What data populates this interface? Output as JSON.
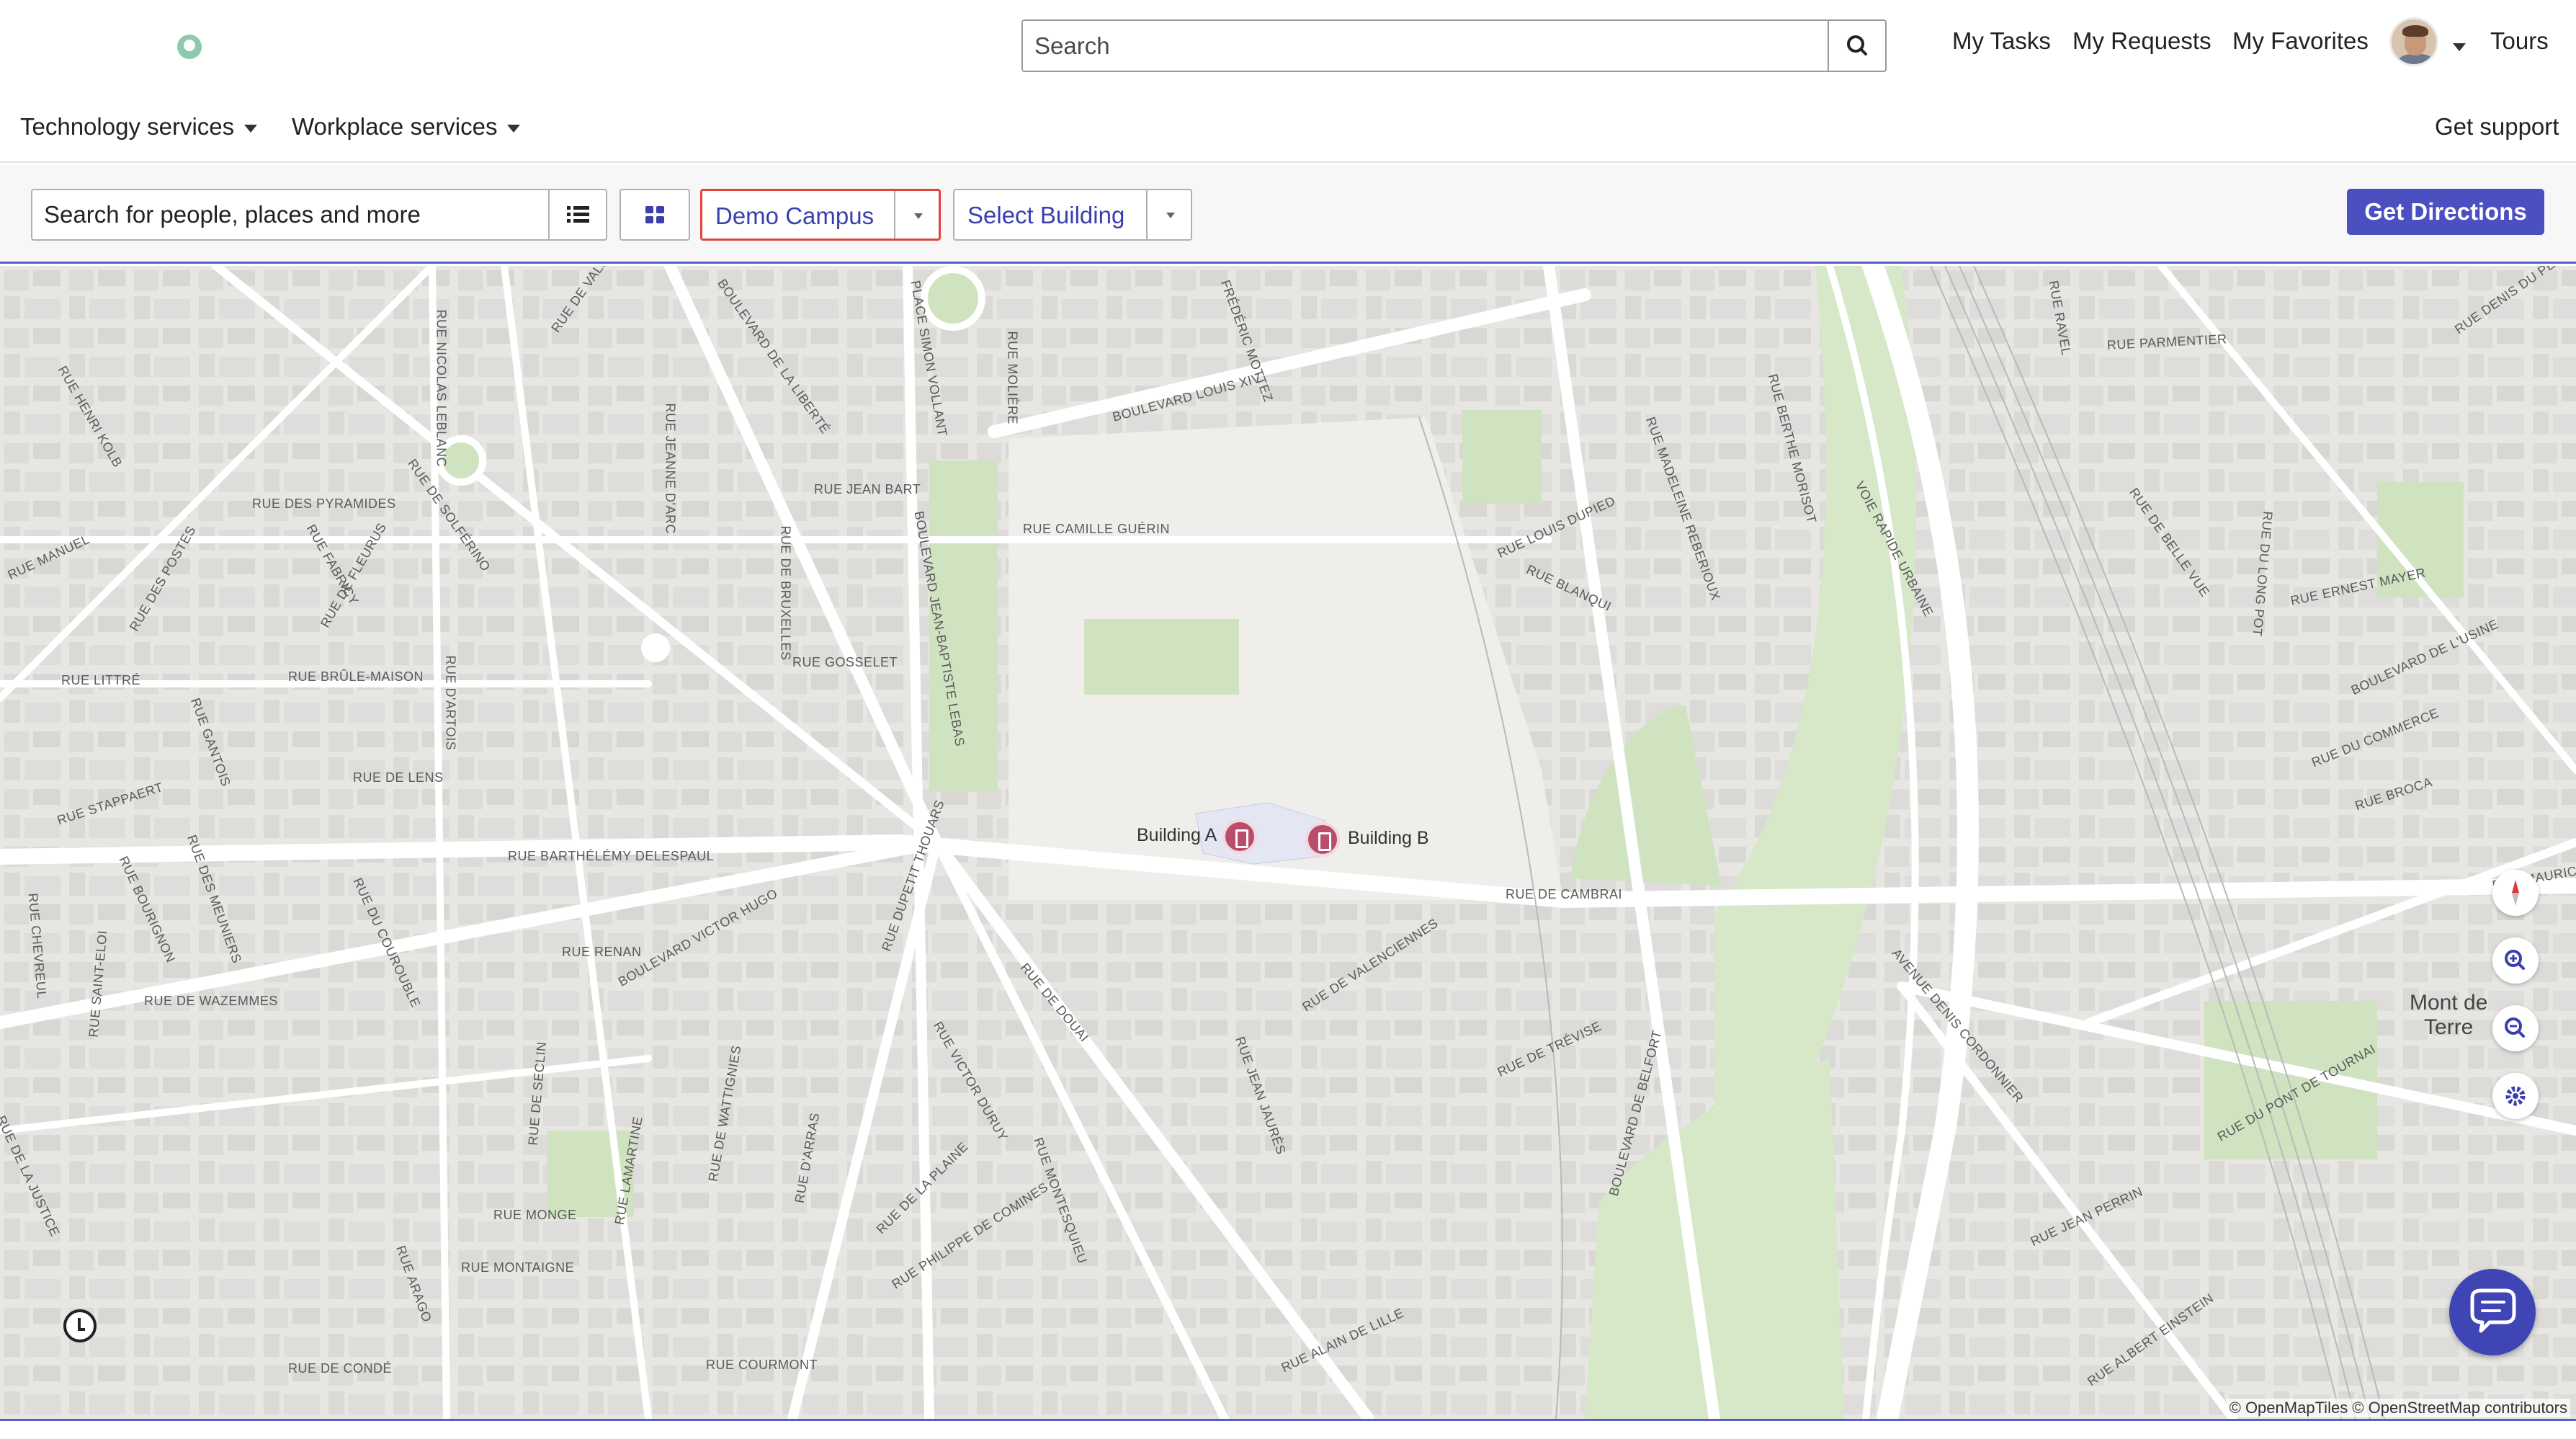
{
  "header": {
    "search_placeholder": "Search",
    "nav": {
      "my_tasks": "My Tasks",
      "my_requests": "My Requests",
      "my_favorites": "My Favorites",
      "tours": "Tours"
    },
    "menu": {
      "technology_services": "Technology services",
      "workplace_services": "Workplace services",
      "get_support": "Get support"
    }
  },
  "toolbar": {
    "people_search_placeholder": "Search for people, places and more",
    "campus_select": "Demo Campus",
    "building_select": "Select Building",
    "get_directions": "Get Directions"
  },
  "map": {
    "markers": [
      {
        "label": "Building A"
      },
      {
        "label": "Building B"
      }
    ],
    "city_label": "Mont de\nTerre",
    "attribution": "© OpenMapTiles © OpenStreetMap contributors",
    "streets": [
      "RUE NICOLAS LEBLANC",
      "RUE DE VALMY",
      "BOULEVARD DE LA LIBERTÉ",
      "PLACE SIMON VOLLANT",
      "RUE MOLIÈRE",
      "FRÉDÉRIC MOTTEZ",
      "BOULEVARD LOUIS XIV",
      "RUE RAVEL",
      "RUE PARMENTIER",
      "RUE DENIS DU PÉAGE",
      "RUE HENRI KOLB",
      "RUE DES PYRAMIDES",
      "RUE DE SOLFÉRINO",
      "RUE JEANNE D'ARC",
      "RUE JEAN BART",
      "RUE MANUEL",
      "RUE DES POSTES",
      "RUE FABRICY",
      "RUE DE FLEURUS",
      "RUE DE BRUXELLES",
      "BOULEVARD JEAN-BAPTISTE LEBAS",
      "RUE CAMILLE GUÉRIN",
      "RUE LOUIS DUPIED",
      "RUE MADELEINE REBERIOUX",
      "RUE BERTHE MORISOT",
      "VOIE RAPIDE URBAINE",
      "RUE DE BELLE VUE",
      "RUE DU LONG POT",
      "RUE ERNEST MAYER",
      "RUE BLANQUI",
      "RUE LITTRÉ",
      "RUE BRÛLE-MAISON",
      "RUE D'ARTOIS",
      "RUE GOSSELET",
      "BOULEVARD DE L'USINE",
      "RUE GANTOIS",
      "RUE DE LENS",
      "RUE STAPPAERT",
      "RUE DU COMMERCE",
      "RUE BROCA",
      "RUE DES MEUNIERS",
      "RUE BOURIGNON",
      "RUE BARTHÉLÉMY DELESPAUL",
      "RUE DU COUROUBLE",
      "RUE DE CAMBRAI",
      "RUE CHEVREUL",
      "RUE RENAN",
      "BOULEVARD VICTOR HUGO",
      "RUE DUPETIT THOUARS",
      "RUE DE DOUAI",
      "RUE DE VALENCIENNES",
      "AVENUE DENIS CORDONNIER",
      "RUE DE WAZEMMES",
      "RUE SAINT-ELOI",
      "RUE VICTOR DURUY",
      "RUE JEAN JAURÈS",
      "RUE DE TRÉVISE",
      "RUE DU PONT DE TOURNAI",
      "RUE DE LA JUSTICE",
      "RUE DE SECLIN",
      "RUE DE WATTIGNIES",
      "RUE D'ARRAS",
      "RUE MONTESQUIEU",
      "BOULEVARD DE BELFORT",
      "RUE MONGE",
      "RUE LAMARTINE",
      "RUE DE LA PLAINE",
      "RUE PHILIPPE DE COMINES",
      "RUE JEAN PERRIN",
      "RUE MONTAIGNE",
      "RUE ARAGO",
      "RUE DE CONDÉ",
      "RUE COURMONT",
      "RUE ALAIN DE LILLE",
      "RUE ALBERT EINSTEIN",
      "RUE MAURICE"
    ]
  },
  "icons": {
    "search": "search-icon",
    "list": "list-icon",
    "grid": "grid-icon",
    "compass": "compass-icon",
    "zoom_in": "zoom-in-icon",
    "zoom_out": "zoom-out-icon",
    "settings": "gear-icon",
    "history": "clock-icon",
    "chat": "chat-icon"
  },
  "colors": {
    "accent": "#4b4fc0",
    "campus_border": "#e0443a",
    "marker": "#b84d6e",
    "park": "#cfe3c0"
  }
}
